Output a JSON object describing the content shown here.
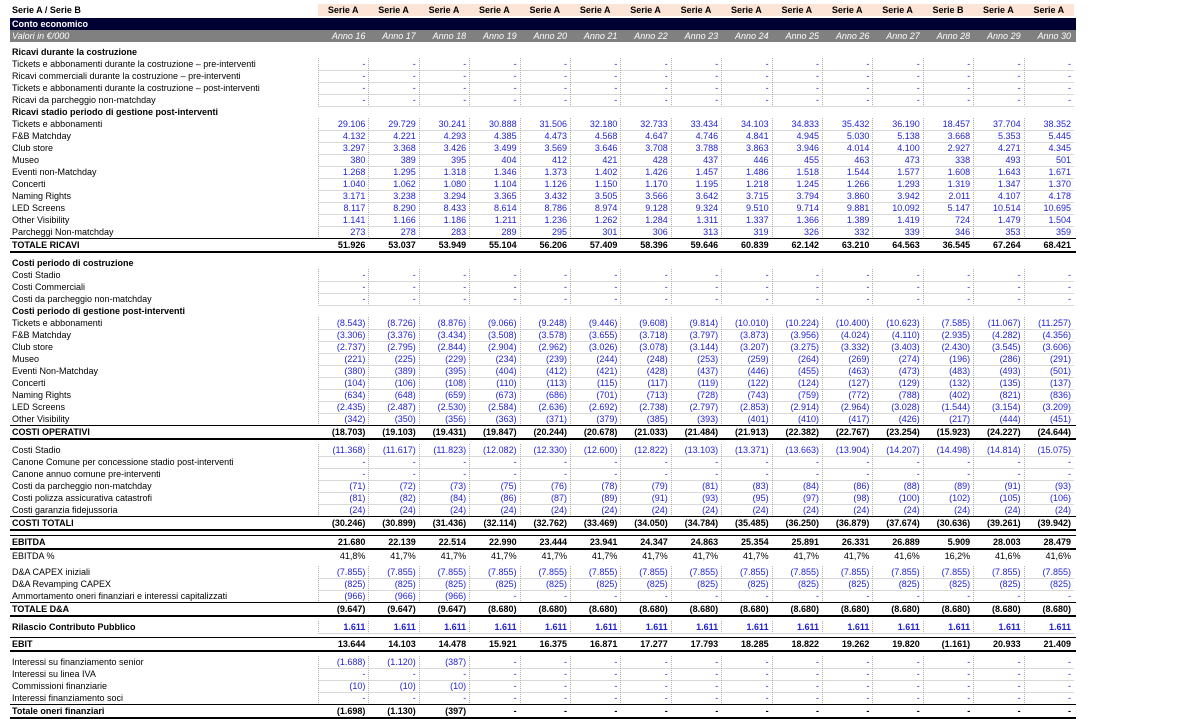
{
  "corner": "Serie A / Serie B",
  "series": [
    "Serie A",
    "Serie A",
    "Serie A",
    "Serie A",
    "Serie A",
    "Serie A",
    "Serie A",
    "Serie A",
    "Serie A",
    "Serie A",
    "Serie A",
    "Serie A",
    "Serie B",
    "Serie A",
    "Serie A"
  ],
  "title": "Conto economico",
  "units": "Valori in €/000",
  "years": [
    "Anno 16",
    "Anno 17",
    "Anno 18",
    "Anno 19",
    "Anno 20",
    "Anno 21",
    "Anno 22",
    "Anno 23",
    "Anno 24",
    "Anno 25",
    "Anno 26",
    "Anno 27",
    "Anno 28",
    "Anno 29",
    "Anno 30"
  ],
  "rows": [
    {
      "label": "Ricavi durante la costruzione",
      "type": "section"
    },
    {
      "label": "Tickets e abbonamenti durante la costruzione – pre-interventi",
      "type": "box",
      "values": [
        "-",
        "-",
        "-",
        "-",
        "-",
        "-",
        "-",
        "-",
        "-",
        "-",
        "-",
        "-",
        "-",
        "-",
        "-"
      ]
    },
    {
      "label": "Ricavi commerciali durante la costruzione – pre-interventi",
      "type": "box",
      "values": [
        "-",
        "-",
        "-",
        "-",
        "-",
        "-",
        "-",
        "-",
        "-",
        "-",
        "-",
        "-",
        "-",
        "-",
        "-"
      ]
    },
    {
      "label": "Tickets e abbonamenti durante la costruzione – post-interventi",
      "type": "box",
      "values": [
        "-",
        "-",
        "-",
        "-",
        "-",
        "-",
        "-",
        "-",
        "-",
        "-",
        "-",
        "-",
        "-",
        "-",
        "-"
      ]
    },
    {
      "label": "Ricavi da parcheggio non-matchday",
      "type": "box",
      "values": [
        "-",
        "-",
        "-",
        "-",
        "-",
        "-",
        "-",
        "-",
        "-",
        "-",
        "-",
        "-",
        "-",
        "-",
        "-"
      ]
    },
    {
      "label": "Ricavi stadio periodo di gestione post-interventi",
      "type": "section"
    },
    {
      "label": "Tickets e abbonamenti",
      "type": "box",
      "values": [
        "29.106",
        "29.729",
        "30.241",
        "30.888",
        "31.506",
        "32.180",
        "32.733",
        "33.434",
        "34.103",
        "34.833",
        "35.432",
        "36.190",
        "18.457",
        "37.704",
        "38.352"
      ]
    },
    {
      "label": "F&B Matchday",
      "type": "box",
      "values": [
        "4.132",
        "4.221",
        "4.293",
        "4.385",
        "4.473",
        "4.568",
        "4.647",
        "4.746",
        "4.841",
        "4.945",
        "5.030",
        "5.138",
        "3.668",
        "5.353",
        "5.445"
      ]
    },
    {
      "label": "Club store",
      "type": "box",
      "values": [
        "3.297",
        "3.368",
        "3.426",
        "3.499",
        "3.569",
        "3.646",
        "3.708",
        "3.788",
        "3.863",
        "3.946",
        "4.014",
        "4.100",
        "2.927",
        "4.271",
        "4.345"
      ]
    },
    {
      "label": "Museo",
      "type": "box",
      "values": [
        "380",
        "389",
        "395",
        "404",
        "412",
        "421",
        "428",
        "437",
        "446",
        "455",
        "463",
        "473",
        "338",
        "493",
        "501"
      ]
    },
    {
      "label": "Eventi non-Matchday",
      "type": "box",
      "values": [
        "1.268",
        "1.295",
        "1.318",
        "1.346",
        "1.373",
        "1.402",
        "1.426",
        "1.457",
        "1.486",
        "1.518",
        "1.544",
        "1.577",
        "1.608",
        "1.643",
        "1.671"
      ]
    },
    {
      "label": "Concerti",
      "type": "box",
      "values": [
        "1.040",
        "1.062",
        "1.080",
        "1.104",
        "1.126",
        "1.150",
        "1.170",
        "1.195",
        "1.218",
        "1.245",
        "1.266",
        "1.293",
        "1.319",
        "1.347",
        "1.370"
      ]
    },
    {
      "label": "Naming Rights",
      "type": "box",
      "values": [
        "3.171",
        "3.238",
        "3.294",
        "3.365",
        "3.432",
        "3.505",
        "3.566",
        "3.642",
        "3.715",
        "3.794",
        "3.860",
        "3.942",
        "2.011",
        "4.107",
        "4.178"
      ]
    },
    {
      "label": "LED Screens",
      "type": "box",
      "values": [
        "8.117",
        "8.290",
        "8.433",
        "8.614",
        "8.786",
        "8.974",
        "9.128",
        "9.324",
        "9.510",
        "9.714",
        "9.881",
        "10.092",
        "5.147",
        "10.514",
        "10.695"
      ]
    },
    {
      "label": "Other Visibility",
      "type": "box",
      "values": [
        "1.141",
        "1.166",
        "1.186",
        "1.211",
        "1.236",
        "1.262",
        "1.284",
        "1.311",
        "1.337",
        "1.366",
        "1.389",
        "1.419",
        "724",
        "1.479",
        "1.504"
      ]
    },
    {
      "label": "Parcheggi Non-matchday",
      "type": "box",
      "values": [
        "273",
        "278",
        "283",
        "289",
        "295",
        "301",
        "306",
        "313",
        "319",
        "326",
        "332",
        "339",
        "346",
        "353",
        "359"
      ]
    },
    {
      "label": "TOTALE RICAVI",
      "type": "total",
      "values": [
        "51.926",
        "53.037",
        "53.949",
        "55.104",
        "56.206",
        "57.409",
        "58.396",
        "59.646",
        "60.839",
        "62.142",
        "63.210",
        "64.563",
        "36.545",
        "67.264",
        "68.421"
      ]
    },
    {
      "type": "gap"
    },
    {
      "label": "Costi periodo di costruzione",
      "type": "section"
    },
    {
      "label": "Costi Stadio",
      "type": "box",
      "values": [
        "-",
        "-",
        "-",
        "-",
        "-",
        "-",
        "-",
        "-",
        "-",
        "-",
        "-",
        "-",
        "-",
        "-",
        "-"
      ]
    },
    {
      "label": "Costi Commerciali",
      "type": "box",
      "values": [
        "-",
        "-",
        "-",
        "-",
        "-",
        "-",
        "-",
        "-",
        "-",
        "-",
        "-",
        "-",
        "-",
        "-",
        "-"
      ]
    },
    {
      "label": "Costi da parcheggio non-matchday",
      "type": "box",
      "values": [
        "-",
        "-",
        "-",
        "-",
        "-",
        "-",
        "-",
        "-",
        "-",
        "-",
        "-",
        "-",
        "-",
        "-",
        "-"
      ]
    },
    {
      "label": "Costi periodo di gestione post-interventi",
      "type": "section"
    },
    {
      "label": "Tickets e abbonamenti",
      "type": "box",
      "values": [
        "(8.543)",
        "(8.726)",
        "(8.876)",
        "(9.066)",
        "(9.248)",
        "(9.446)",
        "(9.608)",
        "(9.814)",
        "(10.010)",
        "(10.224)",
        "(10.400)",
        "(10.623)",
        "(7.585)",
        "(11.067)",
        "(11.257)"
      ]
    },
    {
      "label": "F&B Matchday",
      "type": "box",
      "values": [
        "(3.306)",
        "(3.376)",
        "(3.434)",
        "(3.508)",
        "(3.578)",
        "(3.655)",
        "(3.718)",
        "(3.797)",
        "(3.873)",
        "(3.956)",
        "(4.024)",
        "(4.110)",
        "(2.935)",
        "(4.282)",
        "(4.356)"
      ]
    },
    {
      "label": "Club store",
      "type": "box",
      "values": [
        "(2.737)",
        "(2.795)",
        "(2.844)",
        "(2.904)",
        "(2.962)",
        "(3.026)",
        "(3.078)",
        "(3.144)",
        "(3.207)",
        "(3.275)",
        "(3.332)",
        "(3.403)",
        "(2.430)",
        "(3.545)",
        "(3.606)"
      ]
    },
    {
      "label": "Museo",
      "type": "box",
      "values": [
        "(221)",
        "(225)",
        "(229)",
        "(234)",
        "(239)",
        "(244)",
        "(248)",
        "(253)",
        "(259)",
        "(264)",
        "(269)",
        "(274)",
        "(196)",
        "(286)",
        "(291)"
      ]
    },
    {
      "label": "Eventi Non-Matchday",
      "type": "box",
      "values": [
        "(380)",
        "(389)",
        "(395)",
        "(404)",
        "(412)",
        "(421)",
        "(428)",
        "(437)",
        "(446)",
        "(455)",
        "(463)",
        "(473)",
        "(483)",
        "(493)",
        "(501)"
      ]
    },
    {
      "label": "Concerti",
      "type": "box",
      "values": [
        "(104)",
        "(106)",
        "(108)",
        "(110)",
        "(113)",
        "(115)",
        "(117)",
        "(119)",
        "(122)",
        "(124)",
        "(127)",
        "(129)",
        "(132)",
        "(135)",
        "(137)"
      ]
    },
    {
      "label": "Naming Rights",
      "type": "box",
      "values": [
        "(634)",
        "(648)",
        "(659)",
        "(673)",
        "(686)",
        "(701)",
        "(713)",
        "(728)",
        "(743)",
        "(759)",
        "(772)",
        "(788)",
        "(402)",
        "(821)",
        "(836)"
      ]
    },
    {
      "label": "LED Screens",
      "type": "box",
      "values": [
        "(2.435)",
        "(2.487)",
        "(2.530)",
        "(2.584)",
        "(2.636)",
        "(2.692)",
        "(2.738)",
        "(2.797)",
        "(2.853)",
        "(2.914)",
        "(2.964)",
        "(3.028)",
        "(1.544)",
        "(3.154)",
        "(3.209)"
      ]
    },
    {
      "label": "Other Visibility",
      "type": "box",
      "values": [
        "(342)",
        "(350)",
        "(356)",
        "(363)",
        "(371)",
        "(379)",
        "(385)",
        "(393)",
        "(401)",
        "(410)",
        "(417)",
        "(426)",
        "(217)",
        "(444)",
        "(451)"
      ]
    },
    {
      "label": "COSTI OPERATIVI",
      "type": "total",
      "values": [
        "(18.703)",
        "(19.103)",
        "(19.431)",
        "(19.847)",
        "(20.244)",
        "(20.678)",
        "(21.033)",
        "(21.484)",
        "(21.913)",
        "(22.382)",
        "(22.767)",
        "(23.254)",
        "(15.923)",
        "(24.227)",
        "(24.644)"
      ]
    },
    {
      "type": "gap"
    },
    {
      "label": "Costi Stadio",
      "type": "box",
      "values": [
        "(11.368)",
        "(11.617)",
        "(11.823)",
        "(12.082)",
        "(12.330)",
        "(12.600)",
        "(12.822)",
        "(13.103)",
        "(13.371)",
        "(13.663)",
        "(13.904)",
        "(14.207)",
        "(14.498)",
        "(14.814)",
        "(15.075)"
      ]
    },
    {
      "label": "Canone Comune per concessione stadio post-interventi",
      "type": "box",
      "values": [
        "-",
        "-",
        "-",
        "-",
        "-",
        "-",
        "-",
        "-",
        "-",
        "-",
        "-",
        "-",
        "-",
        "-",
        "-"
      ]
    },
    {
      "label": "Canone annuo comune pre-interventi",
      "type": "box",
      "values": [
        "-",
        "-",
        "-",
        "-",
        "-",
        "-",
        "-",
        "-",
        "-",
        "-",
        "-",
        "-",
        "-",
        "-",
        "-"
      ]
    },
    {
      "label": "Costi da parcheggio non-matchday",
      "type": "box",
      "values": [
        "(71)",
        "(72)",
        "(73)",
        "(75)",
        "(76)",
        "(78)",
        "(79)",
        "(81)",
        "(83)",
        "(84)",
        "(86)",
        "(88)",
        "(89)",
        "(91)",
        "(93)"
      ]
    },
    {
      "label": "Costi polizza assicurativa catastrofi",
      "type": "box",
      "values": [
        "(81)",
        "(82)",
        "(84)",
        "(86)",
        "(87)",
        "(89)",
        "(91)",
        "(93)",
        "(95)",
        "(97)",
        "(98)",
        "(100)",
        "(102)",
        "(105)",
        "(106)"
      ]
    },
    {
      "label": "Costi garanzia fidejussoria",
      "type": "box",
      "values": [
        "(24)",
        "(24)",
        "(24)",
        "(24)",
        "(24)",
        "(24)",
        "(24)",
        "(24)",
        "(24)",
        "(24)",
        "(24)",
        "(24)",
        "(24)",
        "(24)",
        "(24)"
      ]
    },
    {
      "label": "COSTI TOTALI",
      "type": "total",
      "values": [
        "(30.246)",
        "(30.899)",
        "(31.436)",
        "(32.114)",
        "(32.762)",
        "(33.469)",
        "(34.050)",
        "(34.784)",
        "(35.485)",
        "(36.250)",
        "(36.879)",
        "(37.674)",
        "(30.636)",
        "(39.261)",
        "(39.942)"
      ]
    },
    {
      "type": "gap"
    },
    {
      "label": "EBITDA",
      "type": "total",
      "values": [
        "21.680",
        "22.139",
        "22.514",
        "22.990",
        "23.444",
        "23.941",
        "24.347",
        "24.863",
        "25.354",
        "25.891",
        "26.331",
        "26.889",
        "5.909",
        "28.003",
        "28.479"
      ]
    },
    {
      "label": "EBITDA %",
      "type": "plain",
      "values": [
        "41,8%",
        "41,7%",
        "41,7%",
        "41,7%",
        "41,7%",
        "41,7%",
        "41,7%",
        "41,7%",
        "41,7%",
        "41,7%",
        "41,7%",
        "41,6%",
        "16,2%",
        "41,6%",
        "41,6%"
      ]
    },
    {
      "type": "gap"
    },
    {
      "label": "D&A CAPEX iniziali",
      "type": "box",
      "values": [
        "(7.855)",
        "(7.855)",
        "(7.855)",
        "(7.855)",
        "(7.855)",
        "(7.855)",
        "(7.855)",
        "(7.855)",
        "(7.855)",
        "(7.855)",
        "(7.855)",
        "(7.855)",
        "(7.855)",
        "(7.855)",
        "(7.855)"
      ]
    },
    {
      "label": "D&A Revamping CAPEX",
      "type": "box",
      "values": [
        "(825)",
        "(825)",
        "(825)",
        "(825)",
        "(825)",
        "(825)",
        "(825)",
        "(825)",
        "(825)",
        "(825)",
        "(825)",
        "(825)",
        "(825)",
        "(825)",
        "(825)"
      ]
    },
    {
      "label": "Ammortamento oneri finanziari e interessi capitalizzati",
      "type": "box",
      "values": [
        "(966)",
        "(966)",
        "(966)",
        "-",
        "-",
        "-",
        "-",
        "-",
        "-",
        "-",
        "-",
        "-",
        "-",
        "-",
        "-"
      ]
    },
    {
      "label": "TOTALE D&A",
      "type": "total",
      "values": [
        "(9.647)",
        "(9.647)",
        "(9.647)",
        "(8.680)",
        "(8.680)",
        "(8.680)",
        "(8.680)",
        "(8.680)",
        "(8.680)",
        "(8.680)",
        "(8.680)",
        "(8.680)",
        "(8.680)",
        "(8.680)",
        "(8.680)"
      ]
    },
    {
      "type": "gap"
    },
    {
      "label": "Rilascio Contributo Pubblico",
      "type": "boxbold",
      "values": [
        "1.611",
        "1.611",
        "1.611",
        "1.611",
        "1.611",
        "1.611",
        "1.611",
        "1.611",
        "1.611",
        "1.611",
        "1.611",
        "1.611",
        "1.611",
        "1.611",
        "1.611"
      ]
    },
    {
      "type": "gap"
    },
    {
      "label": "EBIT",
      "type": "total",
      "values": [
        "13.644",
        "14.103",
        "14.478",
        "15.921",
        "16.375",
        "16.871",
        "17.277",
        "17.793",
        "18.285",
        "18.822",
        "19.262",
        "19.820",
        "(1.161)",
        "20.933",
        "21.409"
      ]
    },
    {
      "type": "gap"
    },
    {
      "label": "Interessi su finanziamento senior",
      "type": "box",
      "values": [
        "(1.688)",
        "(1.120)",
        "(387)",
        "-",
        "-",
        "-",
        "-",
        "-",
        "-",
        "-",
        "-",
        "-",
        "-",
        "-",
        "-"
      ]
    },
    {
      "label": "Interessi su linea IVA",
      "type": "box",
      "values": [
        "-",
        "-",
        "-",
        "-",
        "-",
        "-",
        "-",
        "-",
        "-",
        "-",
        "-",
        "-",
        "-",
        "-",
        "-"
      ]
    },
    {
      "label": "Commissioni finanziarie",
      "type": "box",
      "values": [
        "(10)",
        "(10)",
        "(10)",
        "-",
        "-",
        "-",
        "-",
        "-",
        "-",
        "-",
        "-",
        "-",
        "-",
        "-",
        "-"
      ]
    },
    {
      "label": "Interessi finanziamento soci",
      "type": "box",
      "values": [
        "-",
        "-",
        "-",
        "-",
        "-",
        "-",
        "-",
        "-",
        "-",
        "-",
        "-",
        "-",
        "-",
        "-",
        "-"
      ]
    },
    {
      "label": "Totale oneri finanziari",
      "type": "total",
      "values": [
        "(1.698)",
        "(1.130)",
        "(397)",
        "-",
        "-",
        "-",
        "-",
        "-",
        "-",
        "-",
        "-",
        "-",
        "-",
        "-",
        "-"
      ]
    }
  ]
}
